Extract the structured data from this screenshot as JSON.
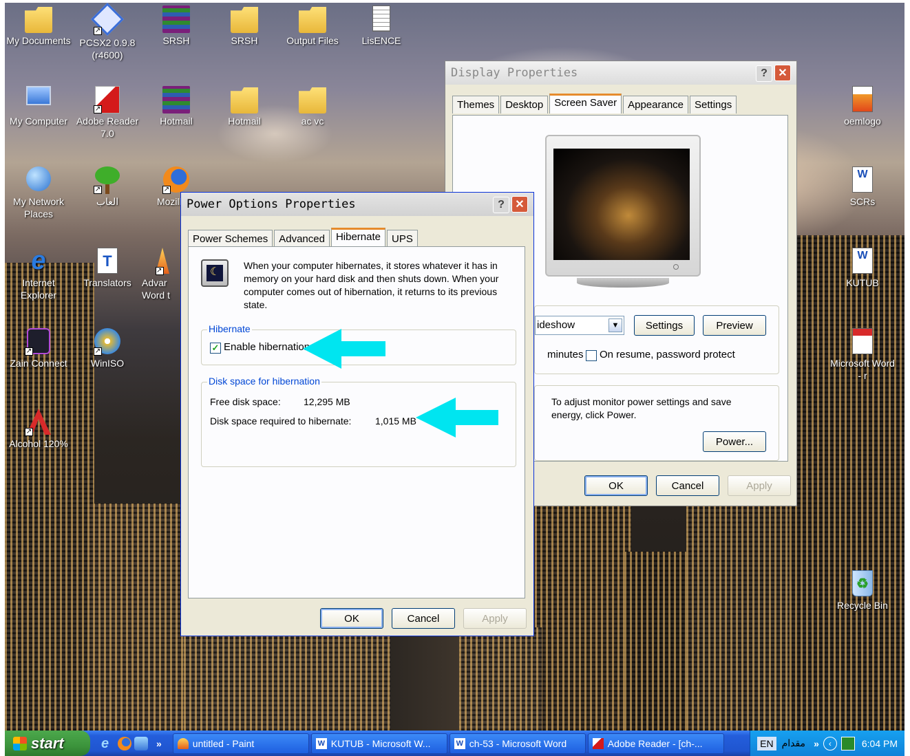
{
  "desktop_icons": [
    {
      "label": "My Documents",
      "icon": "my-documents-icon"
    },
    {
      "label": "PCSX2 0.9.8 (r4600)",
      "icon": "pcsx2-icon"
    },
    {
      "label": "SRSH",
      "icon": "winrar-archive-icon"
    },
    {
      "label": "SRSH",
      "icon": "folder-icon"
    },
    {
      "label": "Output Files",
      "icon": "folder-icon"
    },
    {
      "label": "LisENCE",
      "icon": "text-document-icon"
    },
    {
      "label": "My Computer",
      "icon": "my-computer-icon"
    },
    {
      "label": "Adobe Reader 7.0",
      "icon": "adobe-reader-icon"
    },
    {
      "label": "Hotmail",
      "icon": "winrar-archive-icon"
    },
    {
      "label": "Hotmail",
      "icon": "folder-icon"
    },
    {
      "label": "ac  vc",
      "icon": "folder-icon"
    },
    {
      "label": "My Network Places",
      "icon": "network-places-icon"
    },
    {
      "label": "العاب",
      "icon": "tree-icon"
    },
    {
      "label": "Mozilla F",
      "icon": "firefox-icon"
    },
    {
      "label": "Internet Explorer",
      "icon": "internet-explorer-icon"
    },
    {
      "label": "Translators",
      "icon": "translator-icon"
    },
    {
      "label": "Advar Word t",
      "icon": "advanced-word-icon"
    },
    {
      "label": "Zain Connect",
      "icon": "zain-connect-icon"
    },
    {
      "label": "WinISO",
      "icon": "winiso-icon"
    },
    {
      "label": "Alcohol 120%",
      "icon": "alcohol-icon"
    },
    {
      "label": "oemlogo",
      "icon": "image-file-icon"
    },
    {
      "label": "SCRs",
      "icon": "word-document-icon"
    },
    {
      "label": "KUTUB",
      "icon": "word-document-icon"
    },
    {
      "label": "Microsoft Word - r",
      "icon": "pdf-file-icon"
    },
    {
      "label": "Recycle Bin",
      "icon": "recycle-bin-icon"
    }
  ],
  "display_properties": {
    "title": "Display Properties",
    "tabs": [
      "Themes",
      "Desktop",
      "Screen Saver",
      "Appearance",
      "Settings"
    ],
    "active_tab": "Screen Saver",
    "screensaver_value": "ideshow",
    "settings_label": "Settings",
    "preview_label": "Preview",
    "wait_label": "minutes",
    "password_label": "On resume, password protect",
    "power_text": "To adjust monitor power settings and save energy, click Power.",
    "power_button": "Power...",
    "ok": "OK",
    "cancel": "Cancel",
    "apply": "Apply"
  },
  "power_options": {
    "title": "Power Options Properties",
    "tabs": [
      "Power Schemes",
      "Advanced",
      "Hibernate",
      "UPS"
    ],
    "active_tab": "Hibernate",
    "description": "When your computer hibernates, it stores whatever it has in memory on your hard disk and then shuts down. When your computer comes out of hibernation, it returns to its previous state.",
    "hibernate_group": "Hibernate",
    "enable_label": "Enable hibernation",
    "enable_checked": true,
    "disk_group": "Disk space for hibernation",
    "free_label": "Free disk space:",
    "free_value": "12,295 MB",
    "required_label": "Disk space required to hibernate:",
    "required_value": "1,015 MB",
    "ok": "OK",
    "cancel": "Cancel",
    "apply": "Apply"
  },
  "taskbar": {
    "start": "start",
    "more": "»",
    "tasks": [
      "untitled - Paint",
      "KUTUB - Microsoft W...",
      "ch-53 - Microsoft Word",
      "Adobe Reader - [ch-..."
    ],
    "lang": "EN",
    "arabic": "مقدام",
    "clock": "6:04 PM"
  },
  "colors": {
    "annotation_arrow": "#00e5f0",
    "xp_blue": "#245edb",
    "start_green": "#3c943c"
  }
}
